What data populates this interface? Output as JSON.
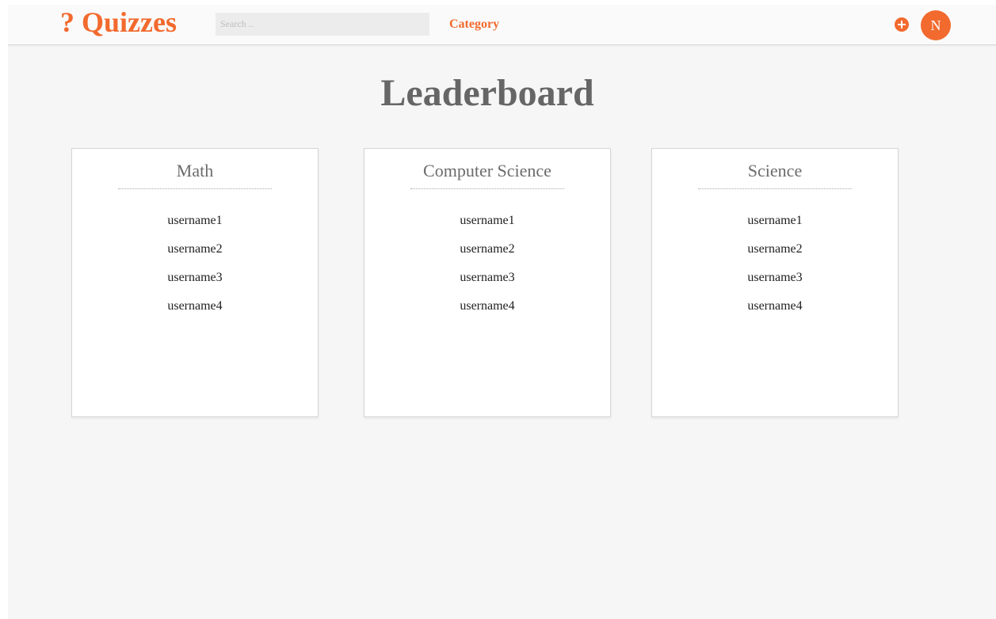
{
  "brand": {
    "mark": "?",
    "name": "Quizzes"
  },
  "search": {
    "placeholder": "Search ..",
    "value": ""
  },
  "nav": {
    "category_label": "Category"
  },
  "user": {
    "avatar_initial": "N"
  },
  "colors": {
    "accent": "#f26a2e",
    "title": "#666666",
    "background": "#f6f6f6"
  },
  "icons": {
    "add": "plus-circle-icon"
  },
  "page": {
    "title": "Leaderboard"
  },
  "cards": [
    {
      "title": "Math",
      "users": [
        "username1",
        "username2",
        "username3",
        "username4"
      ]
    },
    {
      "title": "Computer Science",
      "users": [
        "username1",
        "username2",
        "username3",
        "username4"
      ]
    },
    {
      "title": "Science",
      "users": [
        "username1",
        "username2",
        "username3",
        "username4"
      ]
    }
  ]
}
